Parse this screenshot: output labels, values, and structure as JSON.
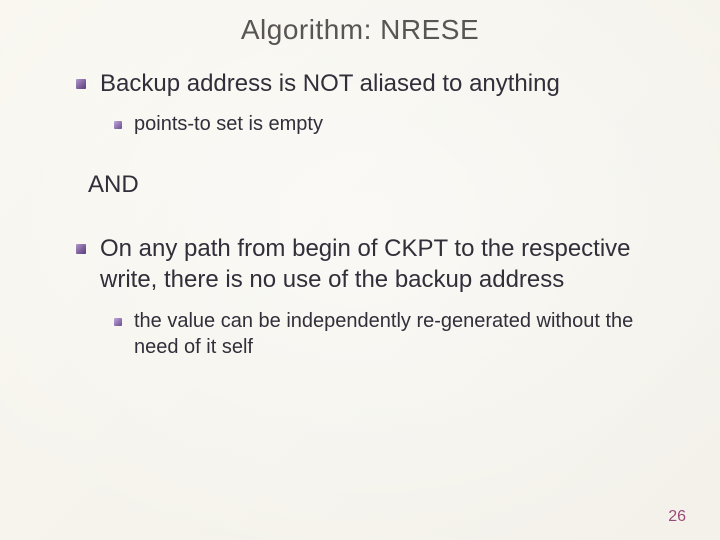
{
  "title": "Algorithm: NRESE",
  "bullets": {
    "first": "Backup address is NOT aliased to anything",
    "first_sub": "points-to set is empty",
    "and": "AND",
    "second": "On any path from begin of CKPT to the respective write, there is no use of the backup address",
    "second_sub": "the value can be independently re-generated without the need of it self"
  },
  "page_number": "26"
}
